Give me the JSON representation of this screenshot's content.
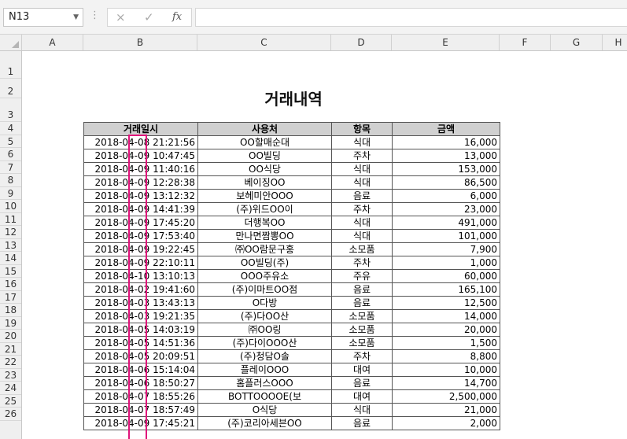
{
  "name_box": "N13",
  "formula_bar": {
    "cancel_icon": "×",
    "enter_icon": "✓",
    "fx_label": "fx",
    "content": ""
  },
  "columns": [
    "A",
    "B",
    "C",
    "D",
    "E",
    "F",
    "G",
    "H"
  ],
  "rows": [
    "1",
    "2",
    "3",
    "4",
    "5",
    "6",
    "7",
    "8",
    "9",
    "10",
    "11",
    "12",
    "13",
    "14",
    "15",
    "16",
    "17",
    "18",
    "19",
    "20",
    "21",
    "22",
    "23",
    "24",
    "25",
    "26"
  ],
  "title": "거래내역",
  "table": {
    "headers": [
      "거래일시",
      "사용처",
      "항목",
      "금액"
    ],
    "rows": [
      [
        "2018-04-08 21:21:56",
        "OO할매순대",
        "식대",
        "16,000"
      ],
      [
        "2018-04-09 10:47:45",
        "OO빌딩",
        "주차",
        "13,000"
      ],
      [
        "2018-04-09 11:40:16",
        "OO식당",
        "식대",
        "153,000"
      ],
      [
        "2018-04-09 12:28:38",
        "베이징OO",
        "식대",
        "86,500"
      ],
      [
        "2018-04-09 13:12:32",
        "보헤미안OOO",
        "음료",
        "6,000"
      ],
      [
        "2018-04-09 14:41:39",
        "(주)위드OO이",
        "주차",
        "23,000"
      ],
      [
        "2018-04-09 17:45:20",
        "더행복OO",
        "식대",
        "491,000"
      ],
      [
        "2018-04-09 17:53:40",
        "만나면짬뽕OO",
        "식대",
        "101,000"
      ],
      [
        "2018-04-09 19:22:45",
        "㈜OO람문구홍",
        "소모품",
        "7,900"
      ],
      [
        "2018-04-09 22:10:11",
        "OO빌딩(주)",
        "주차",
        "1,000"
      ],
      [
        "2018-04-10 13:10:13",
        "OOO주유소",
        "주유",
        "60,000"
      ],
      [
        "2018-04-02 19:41:60",
        "(주)이마트OO점",
        "음료",
        "165,100"
      ],
      [
        "2018-04-03 13:43:13",
        "O다방",
        "음료",
        "12,500"
      ],
      [
        "2018-04-03 19:21:35",
        "(주)다OO산",
        "소모품",
        "14,000"
      ],
      [
        "2018-04-05 14:03:19",
        "㈜OO링",
        "소모품",
        "20,000"
      ],
      [
        "2018-04-05 14:51:36",
        "(주)다이OOO산",
        "소모품",
        "1,500"
      ],
      [
        "2018-04-05 20:09:51",
        "(주)청담O솔",
        "주차",
        "8,800"
      ],
      [
        "2018-04-06 15:14:04",
        "플레이OOO",
        "대여",
        "10,000"
      ],
      [
        "2018-04-06 18:50:27",
        "홈플러스OOO",
        "음료",
        "14,700"
      ],
      [
        "2018-04-07 18:55:26",
        "BOTTOOOOE(보",
        "대여",
        "2,500,000"
      ],
      [
        "2018-04-07 18:57:49",
        "O식당",
        "식대",
        "21,000"
      ],
      [
        "2018-04-09 17:45:21",
        "(주)코리아세븐OO",
        "음료",
        "2,000"
      ]
    ]
  }
}
